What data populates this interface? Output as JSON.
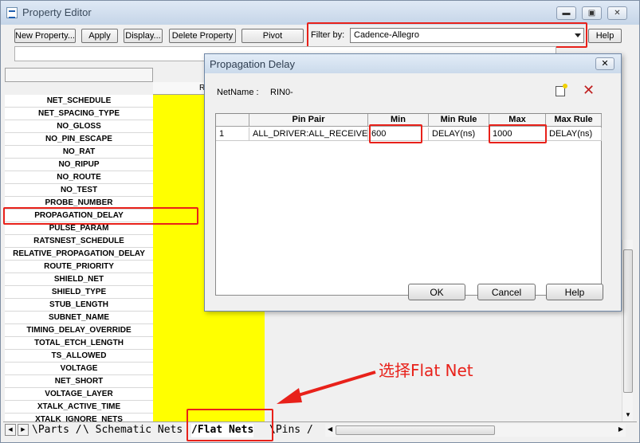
{
  "window": {
    "title": "Property Editor",
    "minimize_icon": "minimize-icon",
    "restore_icon": "restore-icon",
    "close_icon": "close-icon"
  },
  "toolbar": {
    "new_property": "New Property...",
    "apply": "Apply",
    "display": "Display...",
    "delete_property": "Delete Property",
    "pivot": "Pivot",
    "filter_label": "Filter by:",
    "filter_value": "Cadence-Allegro",
    "help": "Help"
  },
  "grid": {
    "column_header_partial": "R",
    "rows": [
      "NET_SCHEDULE",
      "NET_SPACING_TYPE",
      "NO_GLOSS",
      "NO_PIN_ESCAPE",
      "NO_RAT",
      "NO_RIPUP",
      "NO_ROUTE",
      "NO_TEST",
      "PROBE_NUMBER",
      "PROPAGATION_DELAY",
      "PULSE_PARAM",
      "RATSNEST_SCHEDULE",
      "RELATIVE_PROPAGATION_DELAY",
      "ROUTE_PRIORITY",
      "SHIELD_NET",
      "SHIELD_TYPE",
      "STUB_LENGTH",
      "SUBNET_NAME",
      "TIMING_DELAY_OVERRIDE",
      "TOTAL_ETCH_LENGTH",
      "TS_ALLOWED",
      "VOLTAGE",
      "NET_SHORT",
      "VOLTAGE_LAYER",
      "XTALK_ACTIVE_TIME",
      "XTALK_IGNORE_NETS"
    ],
    "highlight_color": "#ffff00"
  },
  "tabs": [
    {
      "label": "Parts"
    },
    {
      "label": "Schematic Nets"
    },
    {
      "label": "Flat Nets"
    },
    {
      "label": "Pins"
    }
  ],
  "annotation": {
    "text": "选择Flat Net",
    "color": "#e8211a"
  },
  "dialog": {
    "title": "Propagation Delay",
    "netname_label": "NetName :",
    "netname_value": "RIN0-",
    "columns": [
      "",
      "Pin Pair",
      "Min",
      "Min Rule",
      "Max",
      "Max Rule"
    ],
    "row": {
      "index": "1",
      "pin_pair": "ALL_DRIVER:ALL_RECEIVER",
      "min": "600",
      "min_rule": "DELAY(ns)",
      "max": "1000",
      "max_rule": "DELAY(ns)"
    },
    "ok": "OK",
    "cancel": "Cancel",
    "help": "Help"
  }
}
